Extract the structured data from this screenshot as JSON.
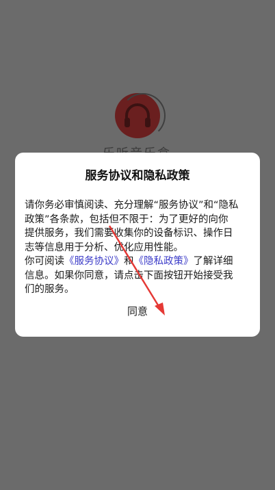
{
  "background": {
    "app_name": "乐听音乐盒",
    "logo_icon": "headphones-icon"
  },
  "dialog": {
    "title": "服务协议和隐私政策",
    "body_line1": "请你务必审慎阅读、充分理解“服务协议”和“隐私",
    "body_line2": "政策”各条款，包括但不限于：为了更好的向你",
    "body_line3": "提供服务，我们需要收集你的设备标识、操作日",
    "body_line4": "志等信息用于分析、优化应用性能。",
    "body_line5_prefix": "你可阅读",
    "service_agreement_link": "《服务协议》",
    "body_line5_and": "和",
    "privacy_policy_link": "《隐私政策》",
    "body_line5_suffix": "了解详细",
    "body_line6": "信息。如果你同意，请点击下面按钮开始接受我",
    "body_line7": "们的服务。",
    "agree_label": "同意"
  },
  "colors": {
    "overlay": "#6b6b6b",
    "link": "#3c3cc8",
    "annotation": "#e53935"
  }
}
